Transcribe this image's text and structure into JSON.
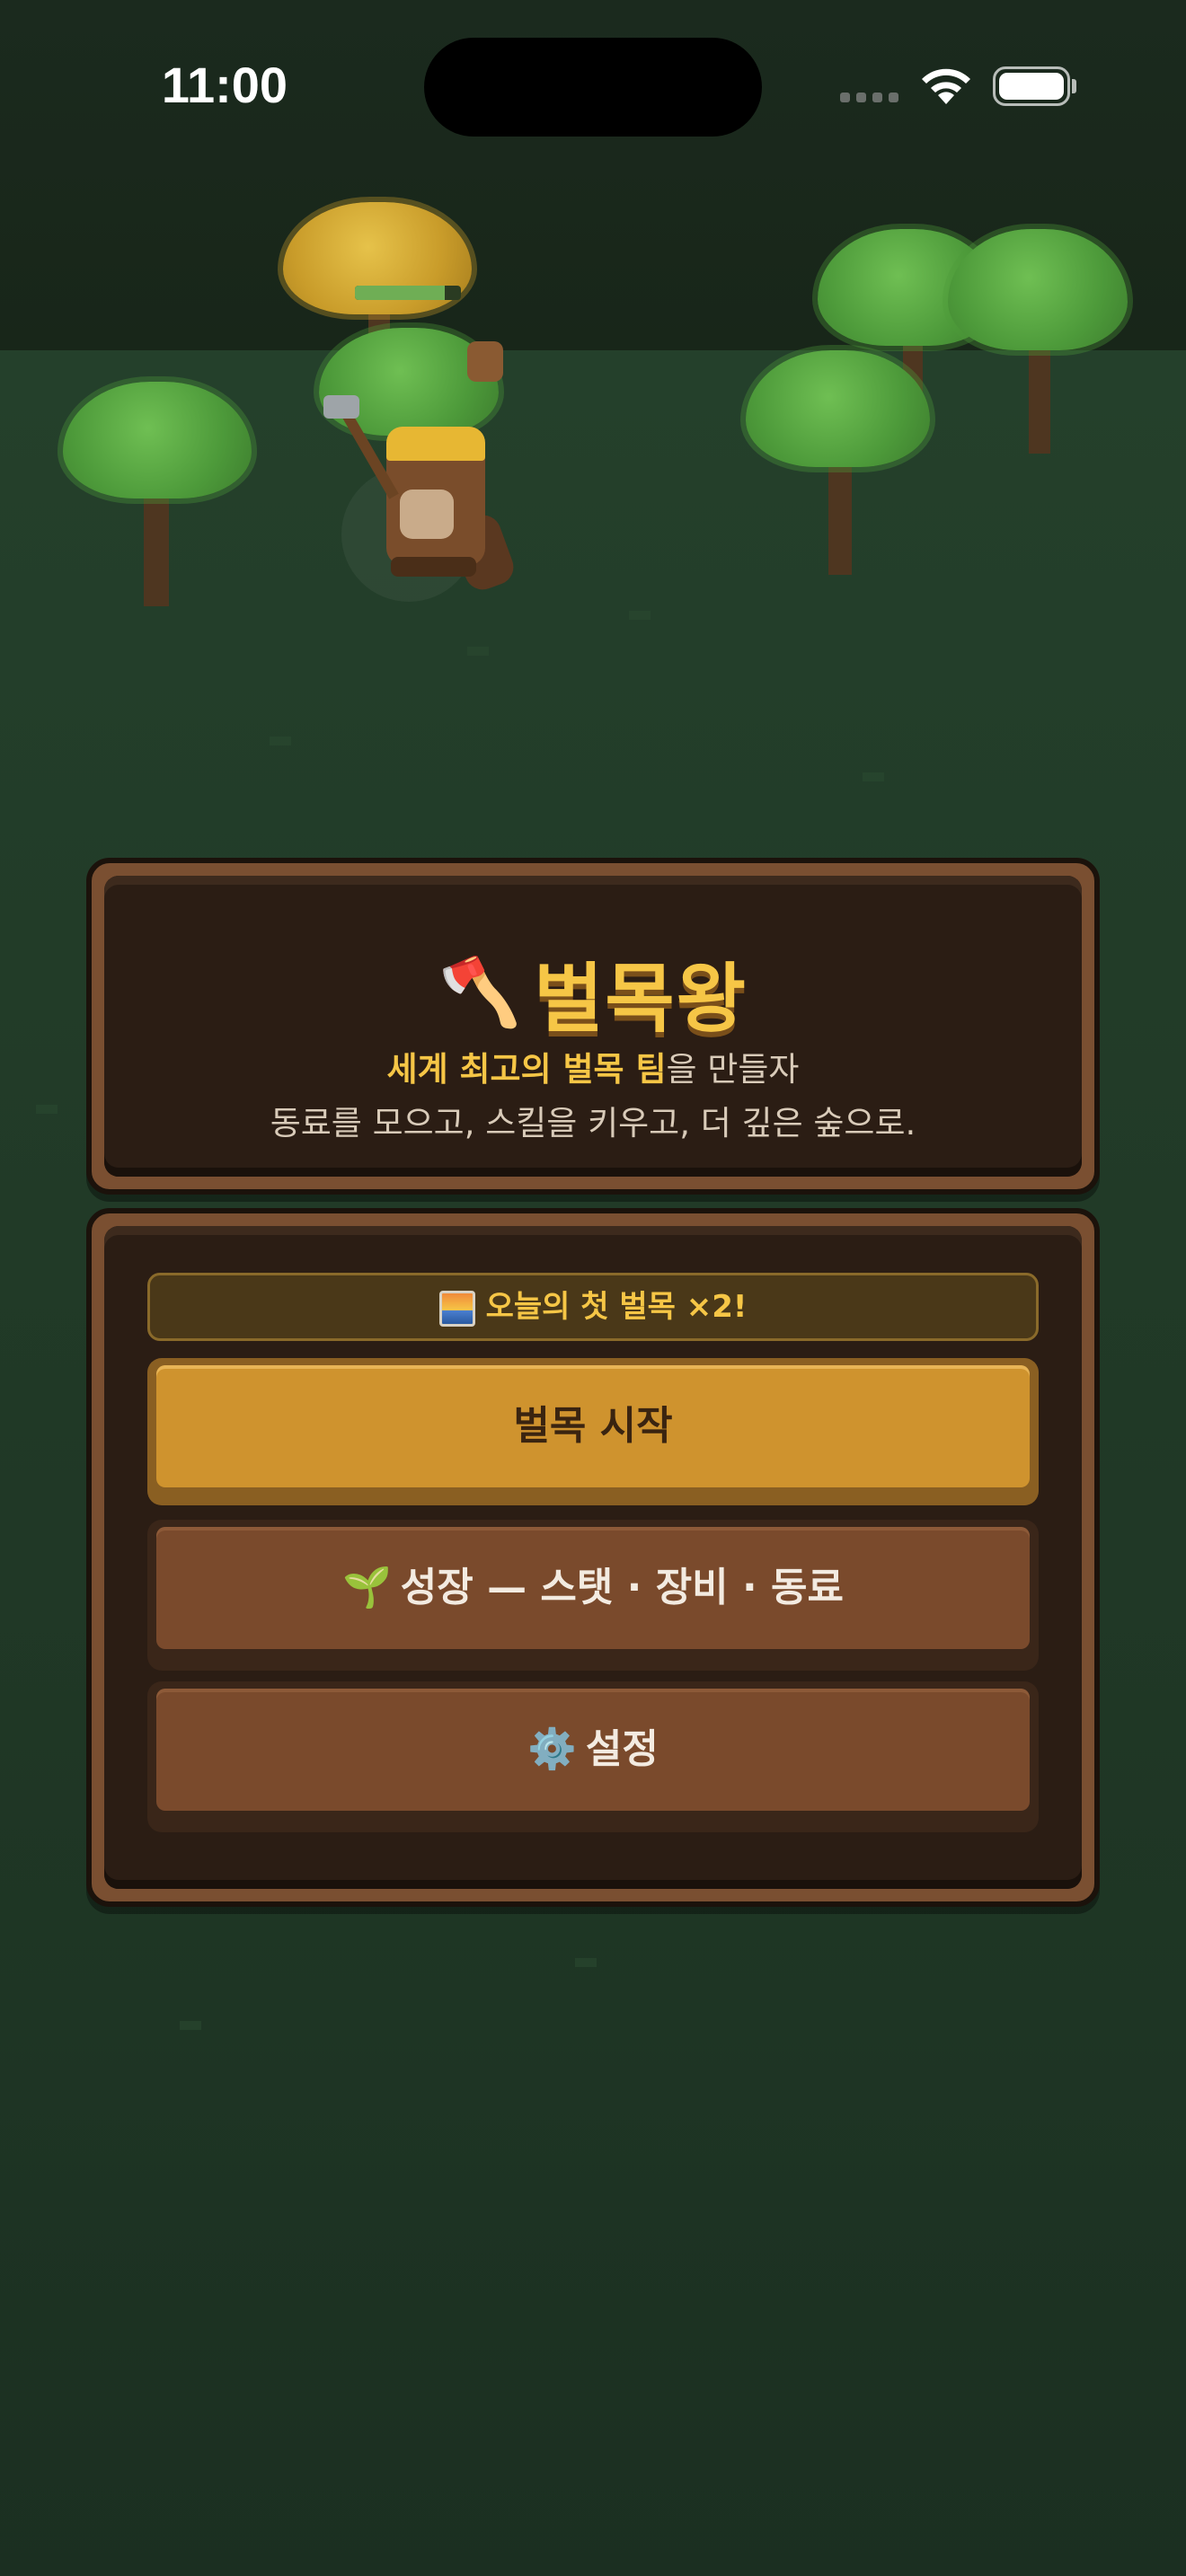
{
  "status_bar": {
    "time": "11:00"
  },
  "title_panel": {
    "icon": "🪓",
    "title": "벌목왕",
    "tagline_highlight": "세계 최고의 벌목 팀",
    "tagline_rest": "을 만들자",
    "tagline2": "동료를 모으고, 스킬을 키우고, 더 깊은 숲으로."
  },
  "menu": {
    "bonus_icon": "🌅",
    "bonus_text": "오늘의 첫 벌목 ×2!",
    "start_label": "벌목 시작",
    "grow_icon": "🌱",
    "grow_label": "성장 — 스탯 · 장비 · 동료",
    "settings_icon": "⚙️",
    "settings_label": "설정"
  },
  "scene": {
    "golden_tree_hp_fraction": 0.85
  },
  "colors": {
    "accent_gold": "#f6c646",
    "panel_wood": "#7a4f31",
    "panel_dark": "#2b1d14",
    "start_button": "#cf932e",
    "secondary_button": "#7a4a2c",
    "forest_bg": "#213a27"
  }
}
